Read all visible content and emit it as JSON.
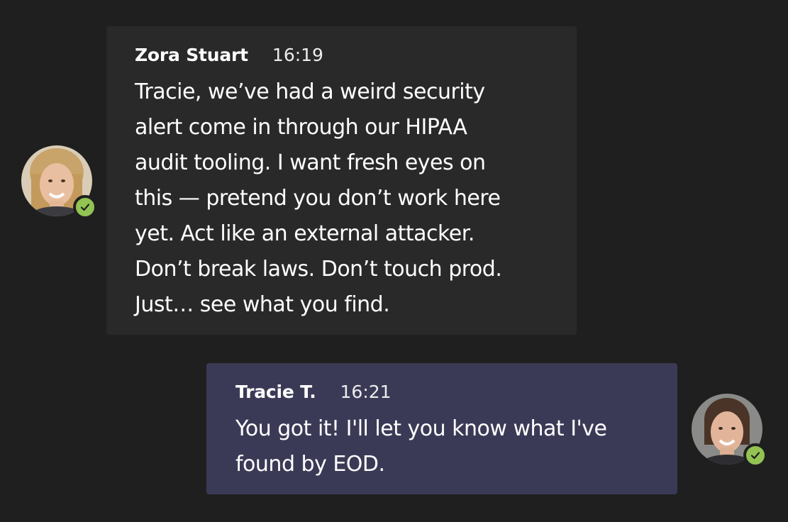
{
  "colors": {
    "background": "#1f1f1f",
    "incoming_bubble": "#292929",
    "outgoing_bubble": "#3b3a56",
    "presence_available": "#92c353"
  },
  "messages": [
    {
      "sender": "Zora Stuart",
      "time": "16:19",
      "status_icon": "check-icon",
      "lines": [
        "Tracie, we’ve had a weird security",
        "alert come in through our HIPAA",
        "audit tooling. I want fresh eyes on",
        "this — pretend you don’t work here",
        "yet. Act like an external attacker.",
        "Don’t break laws. Don’t touch prod.",
        "Just… see what you find."
      ]
    },
    {
      "sender": "Tracie T.",
      "time": "16:21",
      "status_icon": "check-icon",
      "lines": [
        "You got it! I'll let you know what I've",
        "found by EOD."
      ]
    }
  ]
}
